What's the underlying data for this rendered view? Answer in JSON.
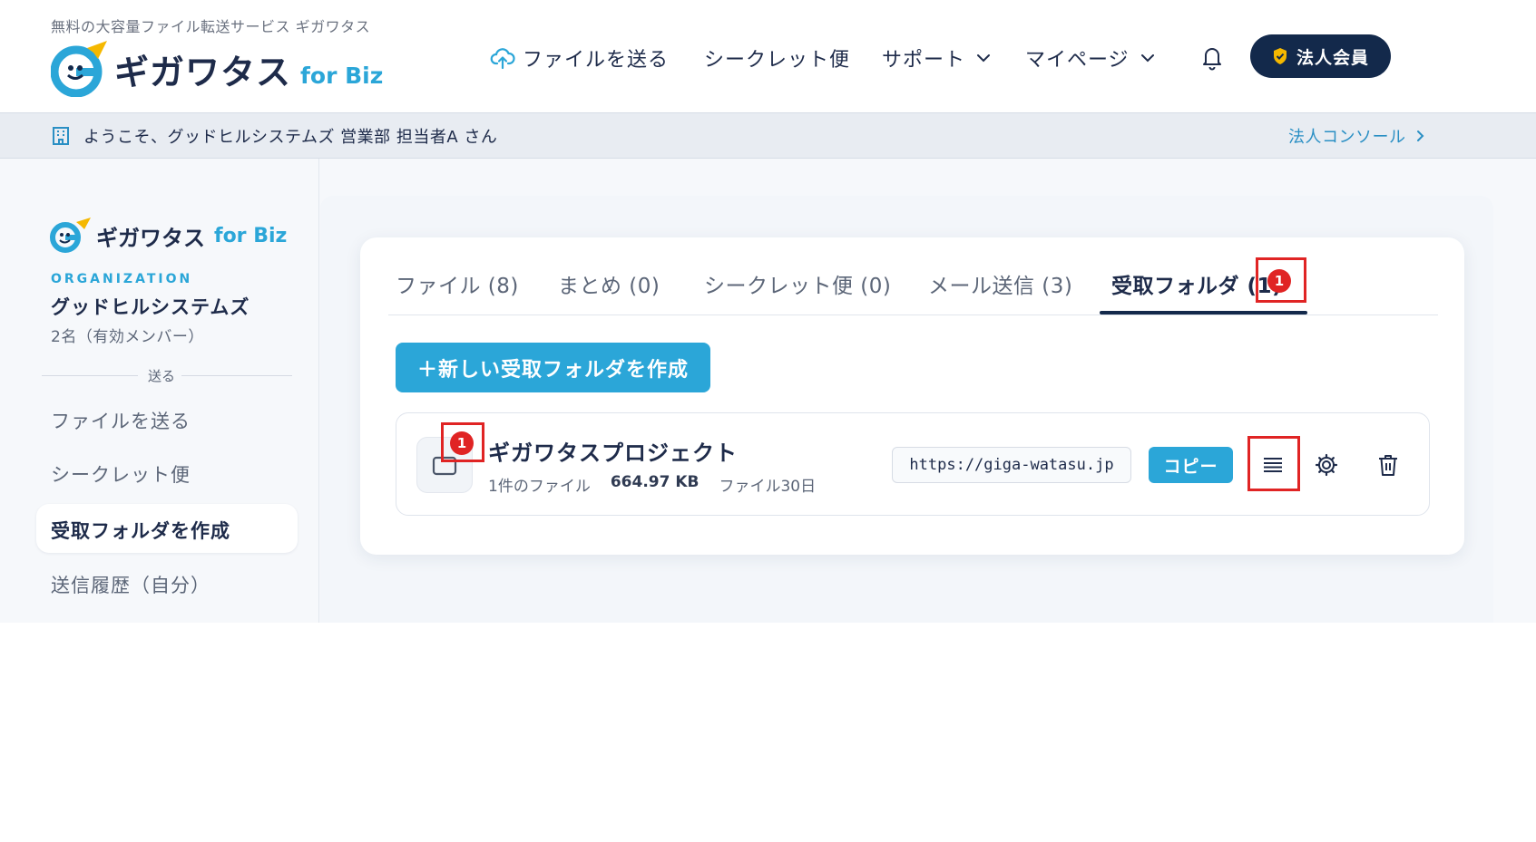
{
  "header": {
    "tagline": "無料の大容量ファイル転送サービス ギガワタス",
    "logo_text": "ギガワタス",
    "logo_biz": "for Biz",
    "nav": [
      {
        "label": "ファイルを送る"
      },
      {
        "label": "シークレット便"
      },
      {
        "label": "サポート"
      },
      {
        "label": "マイページ"
      }
    ],
    "corp_button": "法人会員"
  },
  "welcome": {
    "text": "ようこそ、グッドヒルシステムズ 営業部 担当者A さん",
    "console_link": "法人コンソール"
  },
  "sidebar": {
    "logo_text": "ギガワタス",
    "logo_biz": "for Biz",
    "org_label": "ORGANIZATION",
    "org_name": "グッドヒルシステムズ",
    "org_members": "2名（有効メンバー）",
    "section_label": "送る",
    "items": [
      {
        "label": "ファイルを送る"
      },
      {
        "label": "シークレット便"
      },
      {
        "label": "受取フォルダを作成"
      },
      {
        "label": "送信履歴（自分）"
      }
    ]
  },
  "tabs": [
    {
      "label": "ファイル (8)"
    },
    {
      "label": "まとめ (0)"
    },
    {
      "label": "シークレット便 (0)"
    },
    {
      "label": "メール送信 (3)"
    },
    {
      "label": "受取フォルダ (1)"
    }
  ],
  "tab_badge": "1",
  "new_button": "＋新しい受取フォルダを作成",
  "folder": {
    "badge": "1",
    "title": "ギガワタスプロジェクト",
    "file_count": "1件のファイル",
    "size": "664.97 KB",
    "expiry": "ファイル30日",
    "url": "https://giga-watasu.jp",
    "copy_label": "コピー"
  },
  "colors": {
    "navy": "#13294b",
    "accent": "#2ba6d8",
    "highlight": "#e02424"
  }
}
